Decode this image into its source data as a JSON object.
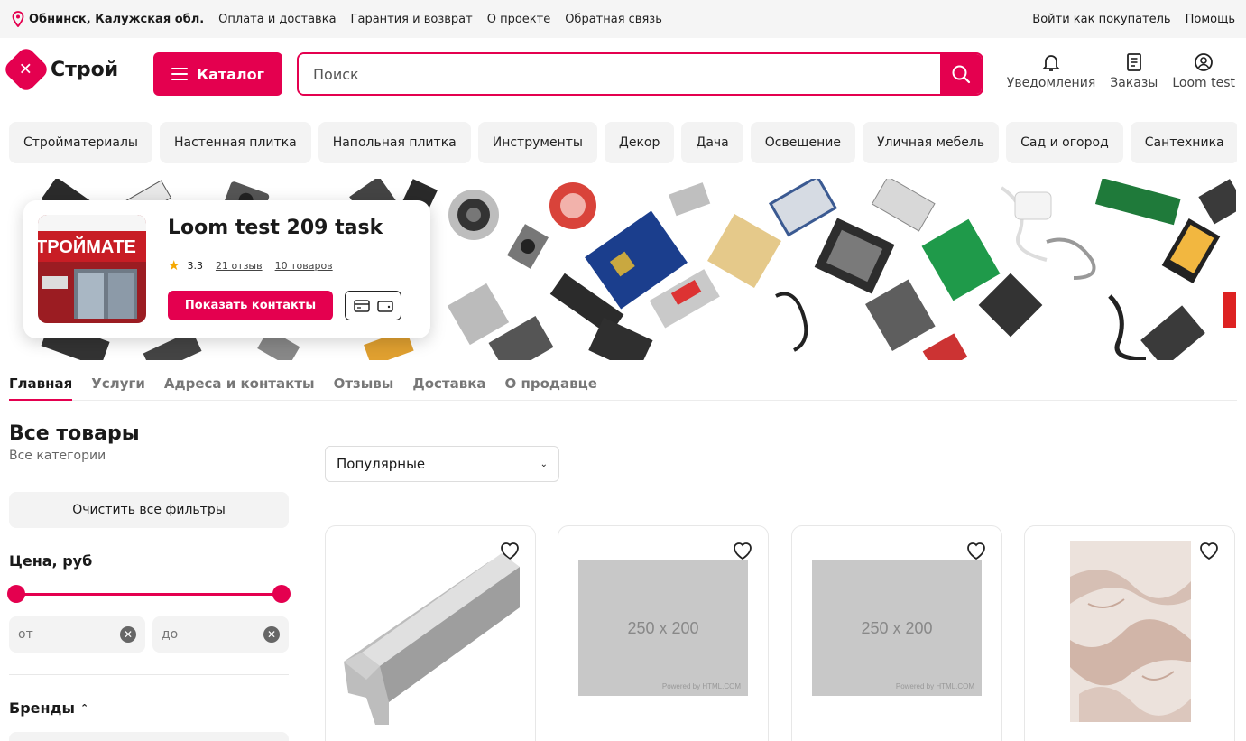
{
  "topbar": {
    "location": "Обнинск, Калужская обл.",
    "links": [
      "Оплата и доставка",
      "Гарантия и возврат",
      "О проекте",
      "Обратная связь"
    ],
    "login": "Войти как покупатель",
    "help": "Помощь"
  },
  "header": {
    "logo_text": "Строй",
    "catalog_label": "Каталог",
    "search_placeholder": "Поиск",
    "notifications_label": "Уведомления",
    "orders_label": "Заказы",
    "account_label": "Loom test"
  },
  "categories": [
    "Стройматериалы",
    "Настенная плитка",
    "Напольная плитка",
    "Инструменты",
    "Декор",
    "Дача",
    "Освещение",
    "Уличная мебель",
    "Сад и огород",
    "Сантехника"
  ],
  "store": {
    "name": "Loom test 209 task",
    "rating": "3.3",
    "reviews_link": "21 отзыв",
    "products_link": "10 товаров",
    "contacts_button": "Показать контакты",
    "photo_sign": "ТРОЙМАТЕ"
  },
  "tabs": [
    "Главная",
    "Услуги",
    "Адреса и контакты",
    "Отзывы",
    "Доставка",
    "О продавце"
  ],
  "filters": {
    "title": "Все товары",
    "subtitle": "Все категории",
    "clear_button": "Очистить все фильтры",
    "price_title": "Цена, руб",
    "from_placeholder": "от",
    "to_placeholder": "до",
    "brands_title": "Бренды"
  },
  "sort": {
    "selected": "Популярные"
  },
  "placeholder": {
    "size_text": "250 x 200",
    "powered_text": "Powered by HTML.COM"
  },
  "colors": {
    "accent": "#e4004f"
  }
}
